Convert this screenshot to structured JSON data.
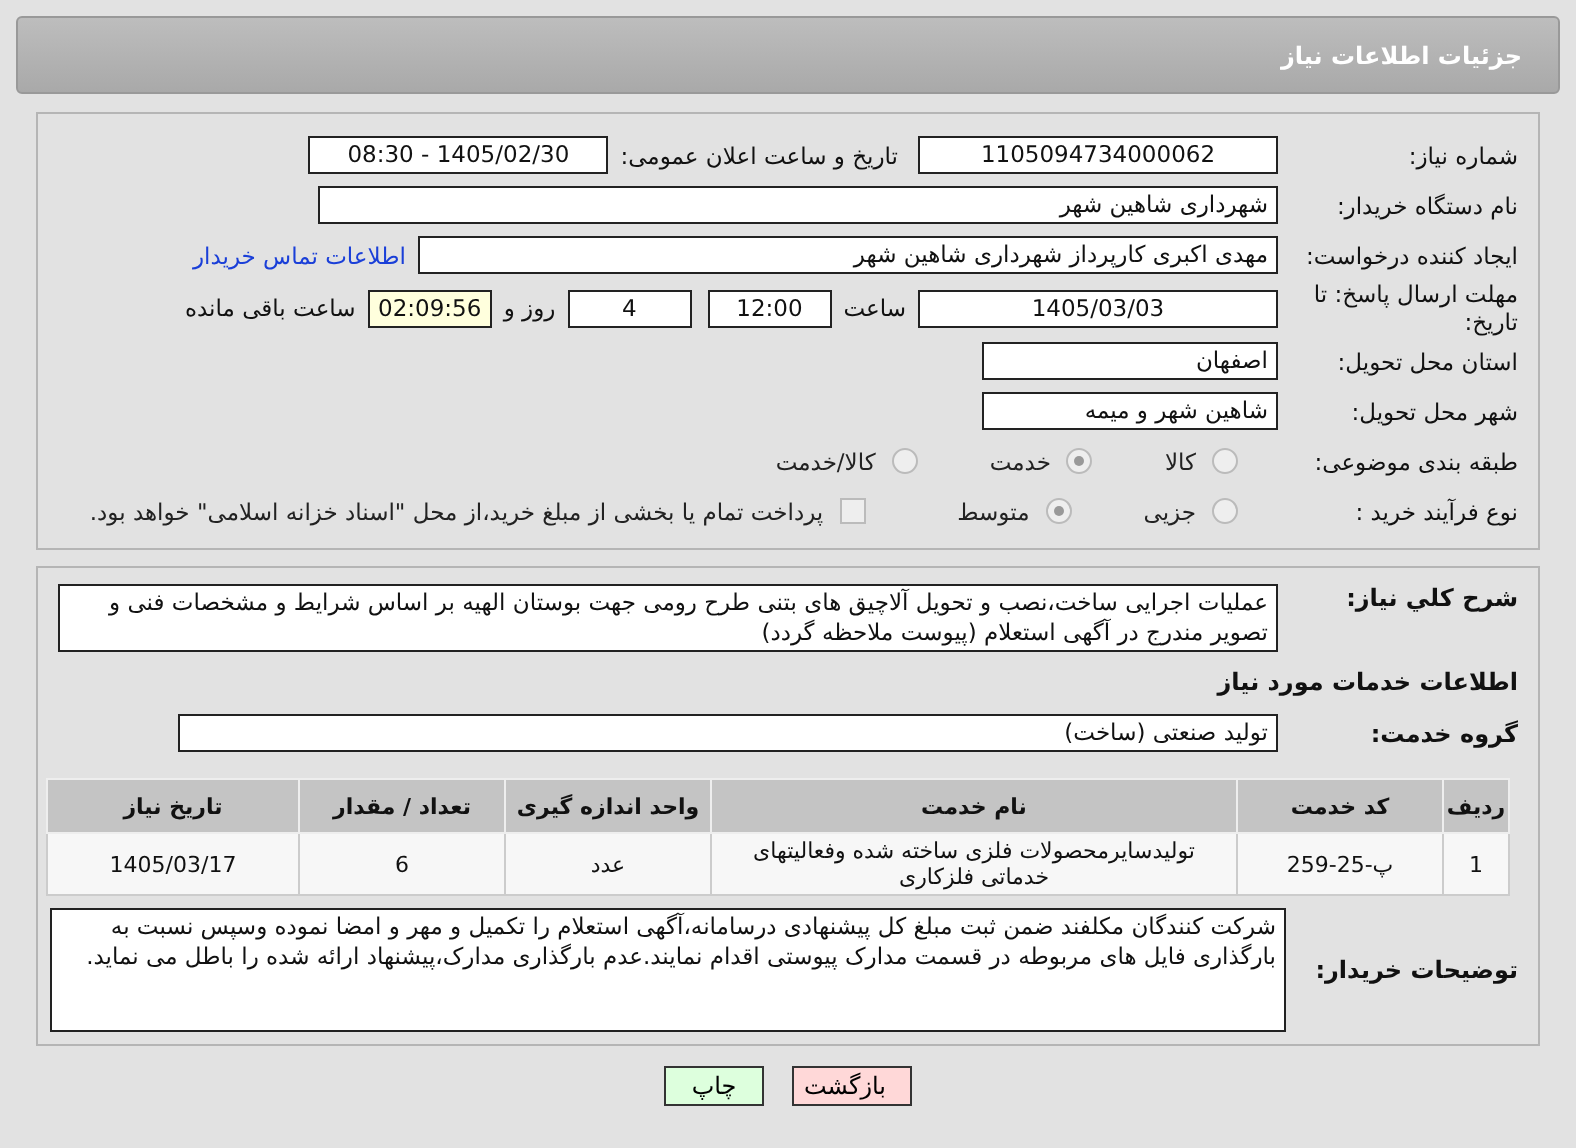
{
  "header": {
    "title": "جزئیات اطلاعات نیاز"
  },
  "need_number": {
    "label": "شماره نیاز:",
    "value": "1105094734000062"
  },
  "announce": {
    "label": "تاریخ و ساعت اعلان عمومی:",
    "value": "1405/02/30 - 08:30"
  },
  "buyer_org": {
    "label": "نام دستگاه خریدار:",
    "value": "شهرداری شاهین شهر"
  },
  "requester": {
    "label": "ایجاد کننده درخواست:",
    "value": "مهدی اکبری کارپرداز شهرداری شاهین شهر",
    "link": "اطلاعات تماس خریدار"
  },
  "deadline": {
    "label": "مهلت ارسال پاسخ: تا تاریخ:",
    "date": "1405/03/03",
    "time_label": "ساعت",
    "time": "12:00",
    "days": "4",
    "days_label": "روز و",
    "remaining": "02:09:56",
    "remaining_label": "ساعت باقی مانده"
  },
  "province": {
    "label": "استان محل تحویل:",
    "value": "اصفهان"
  },
  "city": {
    "label": "شهر محل تحویل:",
    "value": "شاهین شهر و میمه"
  },
  "category": {
    "label": "طبقه بندی موضوعی:",
    "options": [
      {
        "label": "کالا",
        "selected": false
      },
      {
        "label": "خدمت",
        "selected": true
      },
      {
        "label": "کالا/خدمت",
        "selected": false
      }
    ]
  },
  "process": {
    "label": "نوع فرآیند خرید :",
    "options": [
      {
        "label": "جزیی",
        "selected": false
      },
      {
        "label": "متوسط",
        "selected": true
      }
    ],
    "checkbox": {
      "label": "پرداخت تمام یا بخشی از مبلغ خرید،از محل \"اسناد خزانه اسلامی\" خواهد بود.",
      "checked": false
    }
  },
  "description": {
    "label": "شرح كلي نياز:",
    "value": "عملیات اجرایی ساخت،نصب و تحویل آلاچیق های بتنی طرح رومی جهت بوستان الهیه بر اساس شرایط و مشخصات فنی و تصویر مندرج در آگهی استعلام (پیوست ملاحظه گردد)"
  },
  "services_title": "اطلاعات خدمات مورد نیاز",
  "service_group": {
    "label": "گروه خدمت:",
    "value": "تولید صنعتی (ساخت)"
  },
  "table": {
    "columns": [
      "ردیف",
      "کد خدمت",
      "نام خدمت",
      "واحد اندازه گیری",
      "تعداد / مقدار",
      "تاریخ نیاز"
    ],
    "rows": [
      [
        "1",
        "پ-25-259",
        "تولیدسایرمحصولات فلزی ساخته شده وفعالیتهای خدماتی فلزکاری",
        "عدد",
        "6",
        "1405/03/17"
      ]
    ]
  },
  "buyer_notes": {
    "label": "توضیحات خریدار:",
    "value": "شرکت کنندگان مکلفند ضمن ثبت مبلغ کل پیشنهادی درسامانه،آگهی استعلام را  تکمیل و مهر و امضا نموده وسپس نسبت به بارگذاری فایل های مربوطه در قسمت مدارک پیوستی اقدام نمایند.عدم بارگذاری مدارک،پیشنهاد ارائه شده را باطل می نماید."
  },
  "buttons": [
    {
      "label": "بازگشت",
      "kind": "back"
    },
    {
      "label": "چاپ",
      "kind": "print"
    }
  ]
}
